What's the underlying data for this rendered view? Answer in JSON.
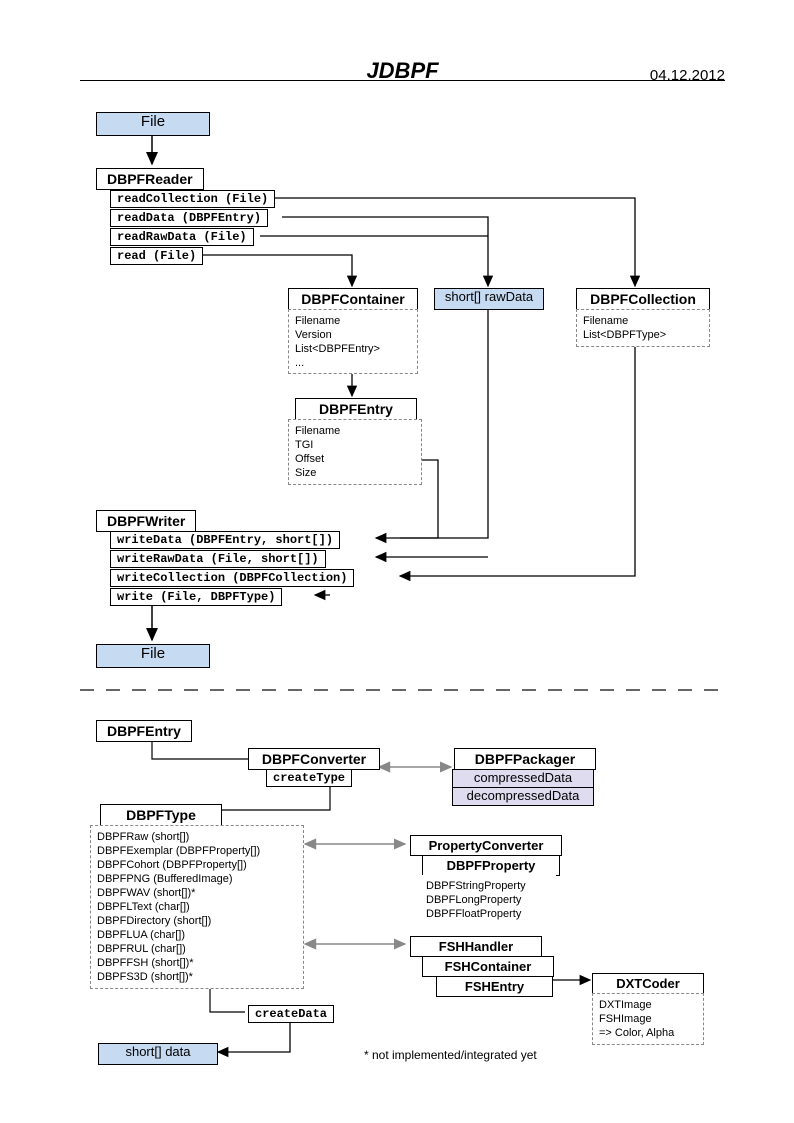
{
  "header": {
    "title": "JDBPF",
    "date": "04.12.2012"
  },
  "top": {
    "file": "File",
    "dbpfreader": "DBPFReader",
    "reader_methods": [
      "readCollection (File)",
      "readData (DBPFEntry)",
      "readRawData (File)",
      "read (File)"
    ],
    "container": "DBPFContainer",
    "container_attrs": "Filename\nVersion\nList<DBPFEntry>\n...",
    "rawdata": "short[] rawData",
    "collection": "DBPFCollection",
    "collection_attrs": "Filename\nList<DBPFType>",
    "entry": "DBPFEntry",
    "entry_attrs": "Filename\nTGI\nOffset\nSize",
    "dbpfwriter": "DBPFWriter",
    "writer_methods": [
      "writeData (DBPFEntry, short[])",
      "writeRawData (File, short[])",
      "writeCollection (DBPFCollection)",
      "write (File, DBPFType)"
    ],
    "file2": "File"
  },
  "bottom": {
    "entry": "DBPFEntry",
    "converter": "DBPFConverter",
    "createType": "createType",
    "packager": "DBPFPackager",
    "compressed": "compressedData",
    "decompressed": "decompressedData",
    "dbpftype": "DBPFType",
    "types_list": "DBPFRaw (short[])\nDBPFExemplar (DBPFProperty[])\nDBPFCohort (DBPFProperty[])\nDBPFPNG (BufferedImage)\nDBPFWAV (short[])*\nDBPFLText (char[])\nDBPFDirectory (short[])\nDBPFLUA (char[])\nDBPFRUL (char[])\nDBPFFSH (short[])*\nDBPFS3D (short[])*",
    "propconv": "PropertyConverter",
    "dbpfprop": "DBPFProperty",
    "prop_attrs": "DBPFStringProperty\nDBPFLongProperty\nDBPFFloatProperty",
    "fshhandler": "FSHHandler",
    "fshcontainer": "FSHContainer",
    "fshentry": "FSHEntry",
    "createData": "createData",
    "dxtcoder": "DXTCoder",
    "dxt_attrs": "DXTImage\nFSHImage\n=> Color, Alpha",
    "shortdata": "short[] data",
    "note": "* not implemented/integrated yet"
  }
}
